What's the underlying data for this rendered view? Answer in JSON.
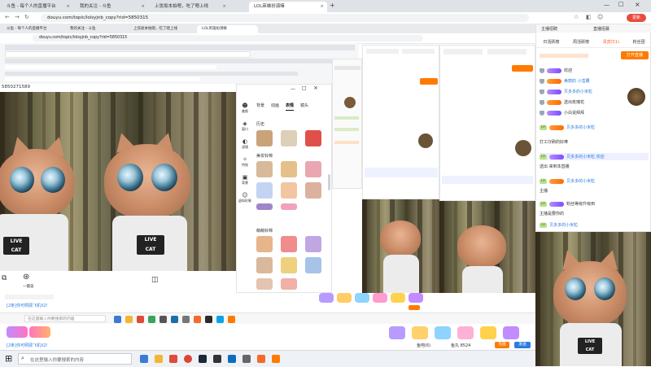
{
  "browser": {
    "tabs": [
      {
        "title": "斗鱼 - 每个人的直播平台"
      },
      {
        "title": "我的关注 - 斗鱼"
      },
      {
        "title": "上弦坂本拍嗯，吃了嗯上线"
      },
      {
        "title": "LOL英雄扮演嘛"
      }
    ],
    "url": "douyu.com/topic/lolsyjnb_copy?rid=5850315",
    "update_label": "更新"
  },
  "nested_browser": {
    "tabs": [
      {
        "title": "斗鱼 - 每个人的直播平台"
      },
      {
        "title": "我的关注 - 斗鱼"
      },
      {
        "title": "上弦坂本拍嗯，吃了嗯上线"
      },
      {
        "title": "LOL英雄扮演嘛"
      }
    ],
    "url": "douyu.com/topic/lolsyjnb_copy?rid=5850315"
  },
  "room_id_partial": "5850271589",
  "camera_window": {
    "side_tools": [
      "美颜",
      "窗口",
      "滤镜",
      "特效",
      "背景",
      "虚拟形象"
    ],
    "tabs": [
      "背景",
      "动画",
      "表情",
      "镜头"
    ],
    "active_tab": "表情",
    "section_history": "历史",
    "section_beauty": "美妆铃棉",
    "section_cute": "萌萌铃棉",
    "bottom_left": "一键美",
    "window_controls": [
      "—",
      "□",
      "×"
    ]
  },
  "right_panel": {
    "tabs": [
      "日活跃榜",
      "周活跃榜",
      "贵宾(51)",
      "粉丝团"
    ],
    "header_tabs": [
      "主播招聘",
      "直播招募"
    ],
    "follow_btn": "打开直播",
    "chat": [
      {
        "text": "欢迎"
      },
      {
        "text": "美丽的 小蛮腰"
      },
      {
        "text": "贝多多的小米粒"
      },
      {
        "text": "送出玫瑰花"
      },
      {
        "text": "小白说拜拜"
      },
      {
        "text": "贝多多的小米粒"
      },
      {
        "text": "打工仔刷的好棒"
      },
      {
        "text": "贝多多的小米粒 欢迎"
      },
      {
        "text": "送出 来到本直播"
      },
      {
        "text": "贝多多的小米粒"
      },
      {
        "text": "主播"
      },
      {
        "text": "粉丝等级升级到"
      },
      {
        "text": "主播是要你的"
      },
      {
        "text": "贝多多的小米粒"
      }
    ]
  },
  "bottom_bar": {
    "chat_placeholder": "在这里输入你要搜索的内容",
    "reply": "[2条]你可照顾飞机X2!",
    "send_btn": "发送",
    "fish_ball": "鱼丸 8524",
    "recharge": "充值",
    "fish_bar": "鱼吧(6)"
  },
  "taskbar": {
    "search_placeholder": "在这里输入你要搜索的内容"
  },
  "chat_preview": {
    "input_placeholder": "在这里输入你要搜索的内容",
    "reply": "[2条]你可照顾飞机X2!"
  },
  "colors": {
    "accent": "#ff7b00",
    "douyu_orange": "#ff5d23",
    "link_blue": "#2b7de0",
    "level_green": "#b9e08c",
    "purple_badge": "#7b4dff"
  }
}
